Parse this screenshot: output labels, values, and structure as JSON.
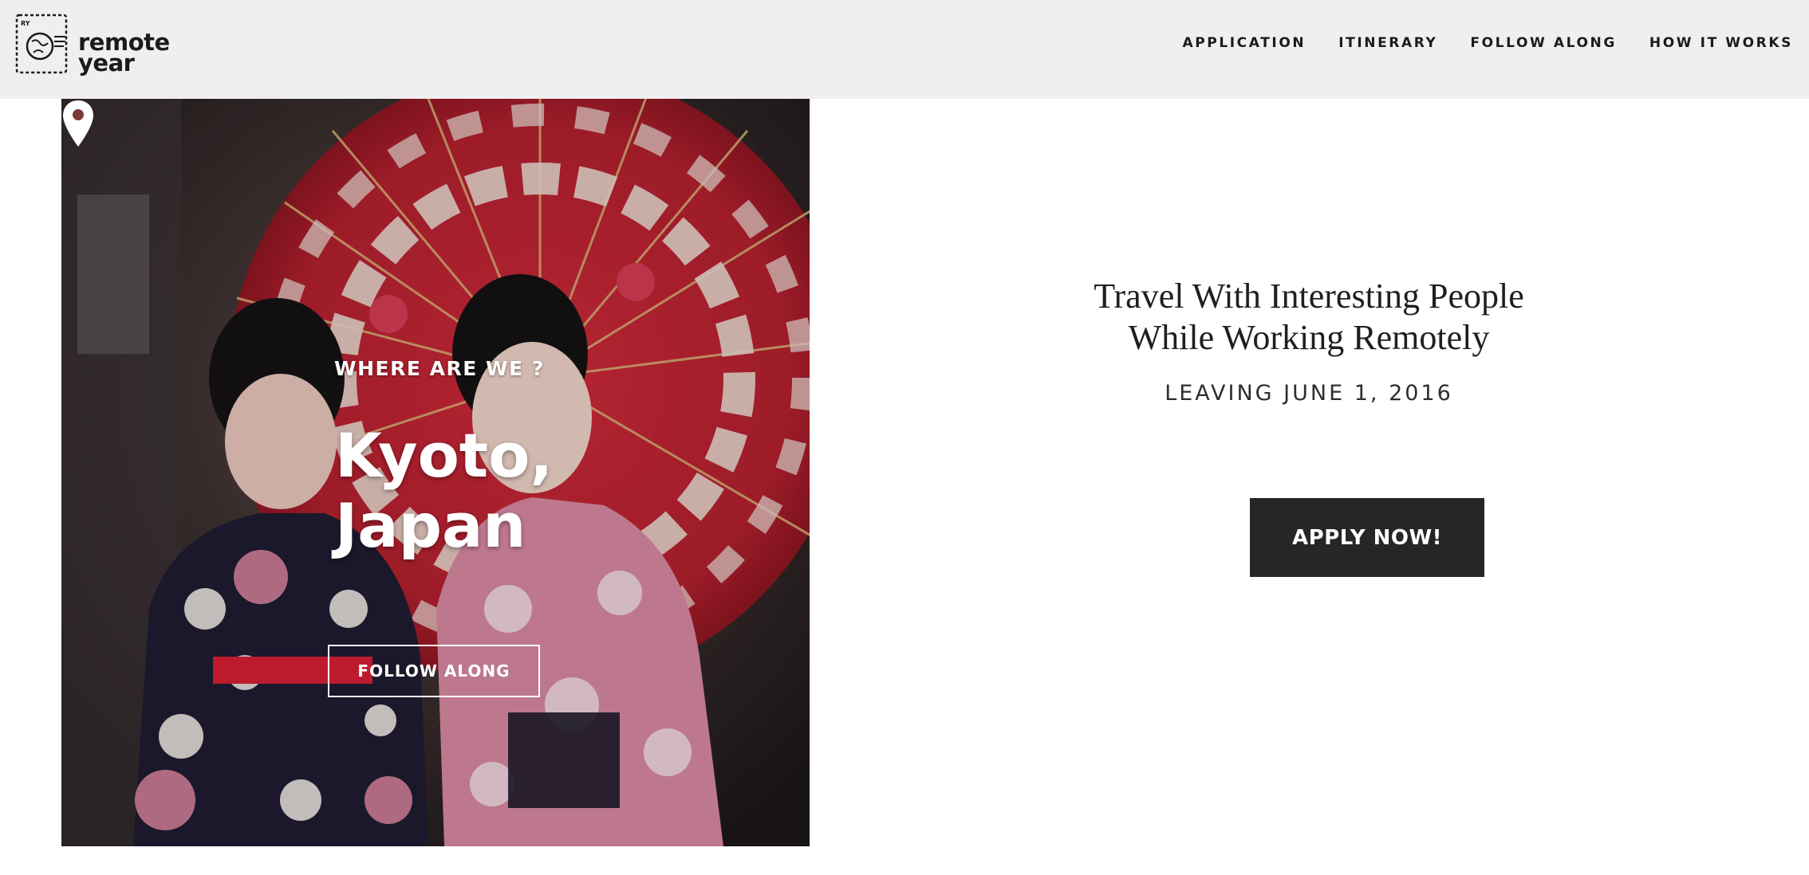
{
  "brand": {
    "name_line1": "remote",
    "name_line2": "year",
    "stamp_text": "RY"
  },
  "nav": {
    "items": [
      {
        "label": "APPLICATION"
      },
      {
        "label": "ITINERARY"
      },
      {
        "label": "FOLLOW ALONG"
      },
      {
        "label": "HOW IT WORKS"
      }
    ]
  },
  "hero": {
    "where_label": "WHERE ARE WE ?",
    "city": "Kyoto,",
    "country": "Japan",
    "follow_label": "FOLLOW ALONG",
    "icon": "location-pin-icon"
  },
  "promo": {
    "headline_line1": "Travel With Interesting People",
    "headline_line2": "While Working Remotely",
    "leaving": "LEAVING JUNE 1, 2016",
    "apply_label": "APPLY NOW!"
  },
  "colors": {
    "topbar_bg": "#f0eeef",
    "button_bg": "#262626",
    "umbrella_red": "#b3202e"
  }
}
